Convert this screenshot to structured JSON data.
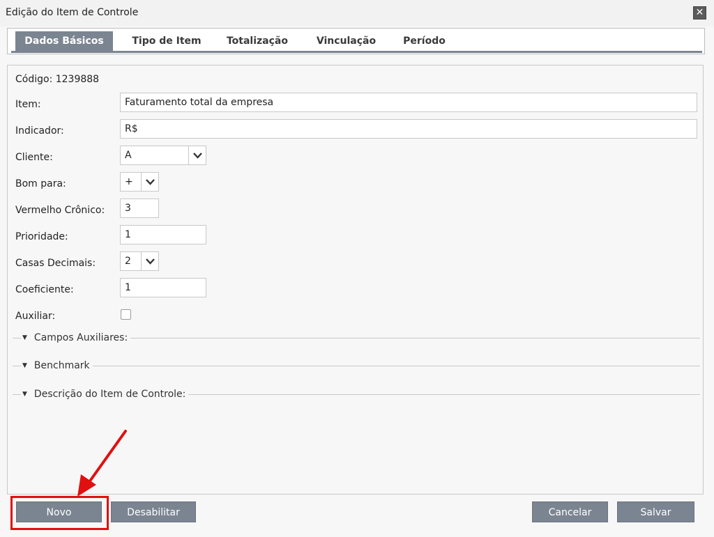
{
  "window": {
    "title": "Edição do Item de Controle",
    "close_glyph": "✕"
  },
  "tabs": [
    {
      "label": "Dados Básicos",
      "active": true
    },
    {
      "label": "Tipo de Item"
    },
    {
      "label": "Totalização"
    },
    {
      "label": "Vinculação"
    },
    {
      "label": "Período"
    }
  ],
  "form": {
    "codigo": "Código: 1239888",
    "item": {
      "label": "Item:",
      "value": "Faturamento total da empresa"
    },
    "indicador": {
      "label": "Indicador:",
      "value": "R$"
    },
    "cliente": {
      "label": "Cliente:",
      "value": "A"
    },
    "bom_para": {
      "label": "Bom para:",
      "value": "+"
    },
    "vermelho_cronico": {
      "label": "Vermelho Crônico:",
      "value": "3"
    },
    "prioridade": {
      "label": "Prioridade:",
      "value": "1"
    },
    "casas_decimais": {
      "label": "Casas Decimais:",
      "value": "2"
    },
    "coeficiente": {
      "label": "Coeficiente:",
      "value": "1"
    },
    "auxiliar": {
      "label": "Auxiliar:",
      "checked": false
    }
  },
  "sections": [
    {
      "label": "Campos Auxiliares:"
    },
    {
      "label": "Benchmark"
    },
    {
      "label": "Descrição do Item de Controle:"
    }
  ],
  "buttons": {
    "novo": "Novo",
    "desabilitar": "Desabilitar",
    "cancelar": "Cancelar",
    "salvar": "Salvar"
  },
  "icons": {
    "dropdown": "chevron-down-icon",
    "section_toggle": "triangle-down-icon",
    "close": "close-icon"
  },
  "colors": {
    "button_bg": "#7b8591",
    "highlight": "#e01010"
  }
}
